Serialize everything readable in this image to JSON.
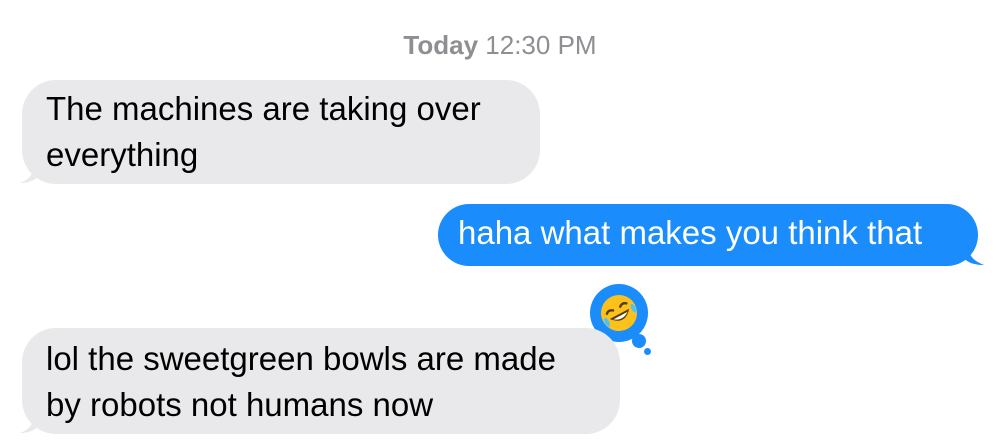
{
  "conversation": {
    "timestamp_day": "Today",
    "timestamp_time": "12:30 PM",
    "messages": [
      {
        "sender": "them",
        "text": "The machines are taking over everything"
      },
      {
        "sender": "me",
        "text": "haha what makes you think that"
      },
      {
        "sender": "them",
        "text": "lol the sweetgreen bowls are made by robots not humans now"
      }
    ],
    "tapback": {
      "on_message": 2,
      "icon": "rolling-on-floor-laughing-emoji"
    }
  },
  "colors": {
    "incoming_bubble": "#e9e9eb",
    "outgoing_bubble": "#1a8cfb",
    "timestamp_text": "#8e8e93"
  }
}
